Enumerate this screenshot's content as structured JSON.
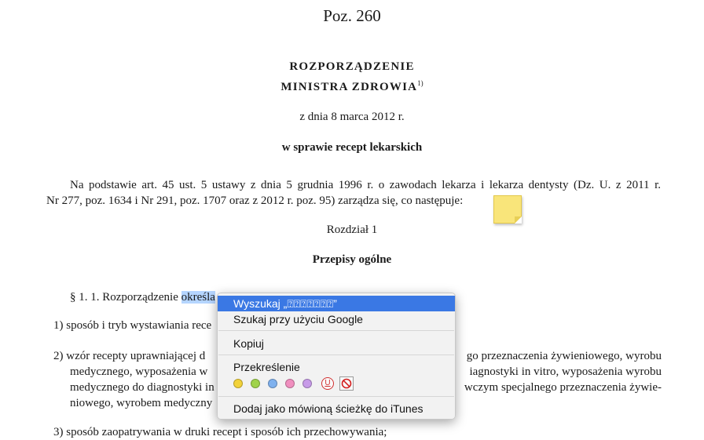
{
  "document": {
    "position_label": "Poz. 260",
    "title_line1": "ROZPORZĄDZENIE",
    "title_line2": "MINISTRA ZDROWIA",
    "title_footnote": "1)",
    "date_line": "z dnia 8 marca 2012 r.",
    "subject": "w sprawie recept lekarskich",
    "preamble_line1": "Na podstawie art. 45 ust. 5 ustawy z dnia 5 grudnia 1996 r. o zawodach lekarza i lekarza dentysty (Dz. U. z 2011 r.",
    "preamble_line2": "Nr 277, poz. 1634 i Nr 291, poz. 1707 oraz z 2012 r. poz. 95) zarządza się, co następuje:",
    "chapter": "Rozdział 1",
    "chapter_title": "Przepisy ogólne",
    "para1_prefix": "§ 1. 1. Rozporządzenie ",
    "para1_selected": "określa",
    "item1": "1) sposób i tryb wystawiania rece",
    "item2_line1_left": "2) wzór recepty uprawniającej d",
    "item2_line1_right": "go przeznaczenia żywieniowego, wyrobu",
    "item2_line2_left": "medycznego, wyposażenia w",
    "item2_line2_right": "iagnostyki in vitro, wyposażenia wyrobu",
    "item2_line3_left": "medycznego do diagnostyki in",
    "item2_line3_right": "wczym specjalnego przeznaczenia żywie-",
    "item2_line4_left": "niowego, wyrobem medyczny",
    "item3": "3) sposób zaopatrywania w druki recept i sposób ich przechowywania;"
  },
  "context_menu": {
    "search_item": "Wyszukaj „⍰⍰⍰⍰⍰⍰⍰”",
    "google_item": "Szukaj przy użyciu Google",
    "copy_item": "Kopiuj",
    "strikethrough_item": "Przekreślenie",
    "underline_glyph": "U",
    "itunes_item": "Dodaj jako mówioną ścieżkę do iTunes",
    "highlight_colors": [
      "#f2d23a",
      "#9fd34a",
      "#7fb1ee",
      "#f08fbf",
      "#c79be8"
    ]
  }
}
